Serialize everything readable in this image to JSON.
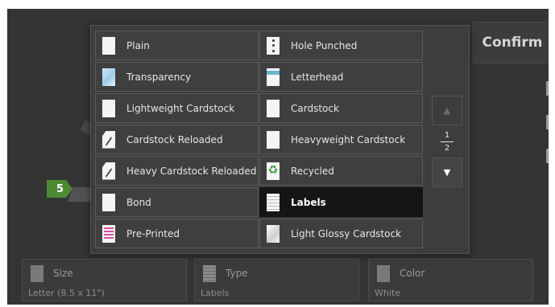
{
  "confirm_label": "Confirm",
  "step_badge": "5",
  "paper_types": [
    {
      "label": "Plain",
      "icon": "plain-paper-icon",
      "selected": false
    },
    {
      "label": "Hole Punched",
      "icon": "hole-punched-paper-icon",
      "selected": false
    },
    {
      "label": "Transparency",
      "icon": "transparency-icon",
      "selected": false
    },
    {
      "label": "Letterhead",
      "icon": "letterhead-icon",
      "selected": false
    },
    {
      "label": "Lightweight Cardstock",
      "icon": "plain-paper-icon",
      "selected": false
    },
    {
      "label": "Cardstock",
      "icon": "plain-paper-icon",
      "selected": false
    },
    {
      "label": "Cardstock Reloaded",
      "icon": "reloaded-paper-icon",
      "selected": false
    },
    {
      "label": "Heavyweight Cardstock",
      "icon": "plain-paper-icon",
      "selected": false
    },
    {
      "label": "Heavy Cardstock Reloaded",
      "icon": "reloaded-paper-icon",
      "selected": false
    },
    {
      "label": "Recycled",
      "icon": "recycled-icon",
      "selected": false
    },
    {
      "label": "Bond",
      "icon": "plain-paper-icon",
      "selected": false
    },
    {
      "label": "Labels",
      "icon": "labels-icon",
      "selected": true
    },
    {
      "label": "Pre-Printed",
      "icon": "pre-printed-icon",
      "selected": false
    },
    {
      "label": "Light Glossy Cardstock",
      "icon": "glossy-paper-icon",
      "selected": false
    }
  ],
  "pager": {
    "current": "1",
    "total": "2"
  },
  "bottom_bar": {
    "size": {
      "title": "Size",
      "value": "Letter (8.5 x 11\")"
    },
    "type": {
      "title": "Type",
      "value": "Labels"
    },
    "color": {
      "title": "Color",
      "value": "White"
    }
  },
  "colors": {
    "selected_tile": "#151515",
    "badge": "#4e8a34",
    "recycle": "#3f9a3a"
  }
}
